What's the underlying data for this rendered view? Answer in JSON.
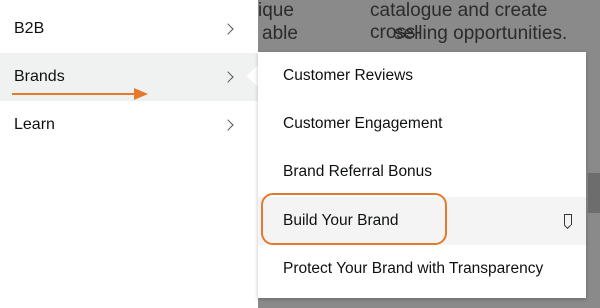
{
  "background": {
    "fragments": [
      "ique",
      "able",
      "catalogue and create cross-",
      "selling opportunities."
    ]
  },
  "left_menu": {
    "items": [
      {
        "label": "B2B"
      },
      {
        "label": "Brands"
      },
      {
        "label": "Learn"
      }
    ]
  },
  "submenu": {
    "items": [
      {
        "label": "Customer Reviews"
      },
      {
        "label": "Customer Engagement"
      },
      {
        "label": "Brand Referral Bonus"
      },
      {
        "label": "Build Your Brand"
      },
      {
        "label": "Protect Your Brand with Transparency"
      }
    ]
  },
  "colors": {
    "accent": "#e47a2e",
    "active_bg": "#f0f2f2",
    "overlay": "#8a8a8a"
  },
  "icons": {
    "chevron": "chevron-right-icon",
    "bookmark": "bookmark-icon"
  }
}
